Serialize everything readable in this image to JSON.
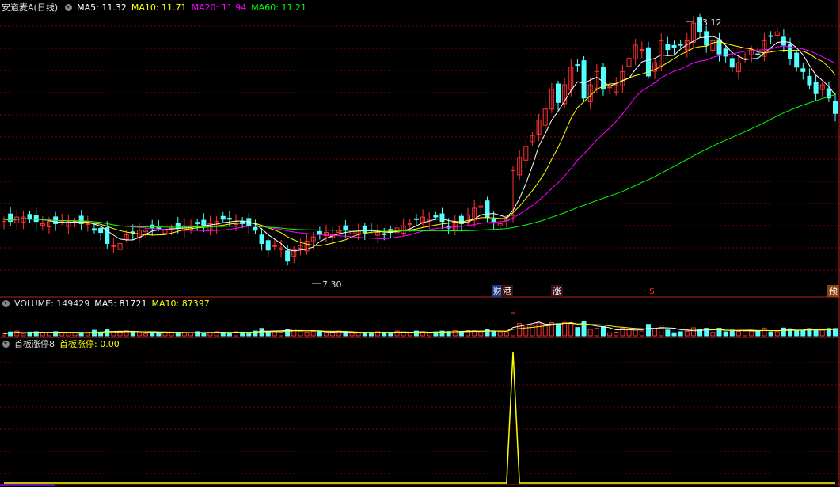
{
  "main_header": {
    "title": "安道麦A(日线)",
    "ma5": "MA5: 11.32",
    "ma10": "MA10: 11.71",
    "ma20": "MA20: 11.94",
    "ma60": "MA60: 11.21"
  },
  "volume_header": {
    "title": "VOLUME: 149429",
    "ma5": "MA5: 81721",
    "ma10": "MA10: 87397"
  },
  "indicator_header": {
    "title": "首板涨停8",
    "value": "首板涨停: 0.00"
  },
  "markers": {
    "high_label": "13.12",
    "low_label": "7.30",
    "tag_cai": "财",
    "tag_gang": "港",
    "tag_zhang": "涨",
    "tag_dollar": "$",
    "tag_yu": "预"
  },
  "colors": {
    "up": "#ff3232",
    "down": "#54ffff",
    "ma5": "#ffffff",
    "ma10": "#ffff00",
    "ma20": "#ff00ff",
    "ma60": "#00ff00",
    "grid": "#8b0000",
    "indicator": "#ffff00"
  },
  "chart_data": {
    "type": "candlestick",
    "high": 13.12,
    "low": 7.3,
    "last_close_ma": {
      "ma5": 11.32,
      "ma10": 11.71,
      "ma20": 11.94,
      "ma60": 11.21
    },
    "closes": [
      8.55,
      8.5,
      8.6,
      8.6,
      8.55,
      8.5,
      8.45,
      8.5,
      8.45,
      8.5,
      8.5,
      8.5,
      8.45,
      8.45,
      8.3,
      8.25,
      8.0,
      7.95,
      8.0,
      8.2,
      8.25,
      8.3,
      8.3,
      8.35,
      8.35,
      8.3,
      8.35,
      8.35,
      8.4,
      8.4,
      8.45,
      8.4,
      8.45,
      8.5,
      8.55,
      8.55,
      8.5,
      8.45,
      8.4,
      8.3,
      8.0,
      7.85,
      7.95,
      7.9,
      7.6,
      7.85,
      7.95,
      8.05,
      8.15,
      8.2,
      8.25,
      8.2,
      8.3,
      8.3,
      8.3,
      8.3,
      8.25,
      8.3,
      8.25,
      8.2,
      8.25,
      8.35,
      8.4,
      8.45,
      8.55,
      8.6,
      8.55,
      8.6,
      8.5,
      8.35,
      8.5,
      8.45,
      8.65,
      8.8,
      8.85,
      8.6,
      8.5,
      8.45,
      8.55,
      9.65,
      9.95,
      10.2,
      10.45,
      10.8,
      11.05,
      11.5,
      11.2,
      11.6,
      12.0,
      12.05,
      11.3,
      11.6,
      11.9,
      11.5,
      11.55,
      11.6,
      11.9,
      12.2,
      12.5,
      12.4,
      11.8,
      12.1,
      12.6,
      12.4,
      12.45,
      12.5,
      12.6,
      13.0,
      12.8,
      12.5,
      12.6,
      12.3,
      12.25,
      12.0,
      12.1,
      12.2,
      12.4,
      12.3,
      12.6,
      12.7,
      12.8,
      12.5,
      12.2,
      12.0,
      11.9,
      11.6,
      11.4,
      11.6,
      11.3,
      10.95
    ],
    "volume_ma5": 81721,
    "volume_ma10": 87397,
    "last_volume": 149429,
    "indicator_spike_value": 1.0,
    "indicator_current": 0.0
  }
}
